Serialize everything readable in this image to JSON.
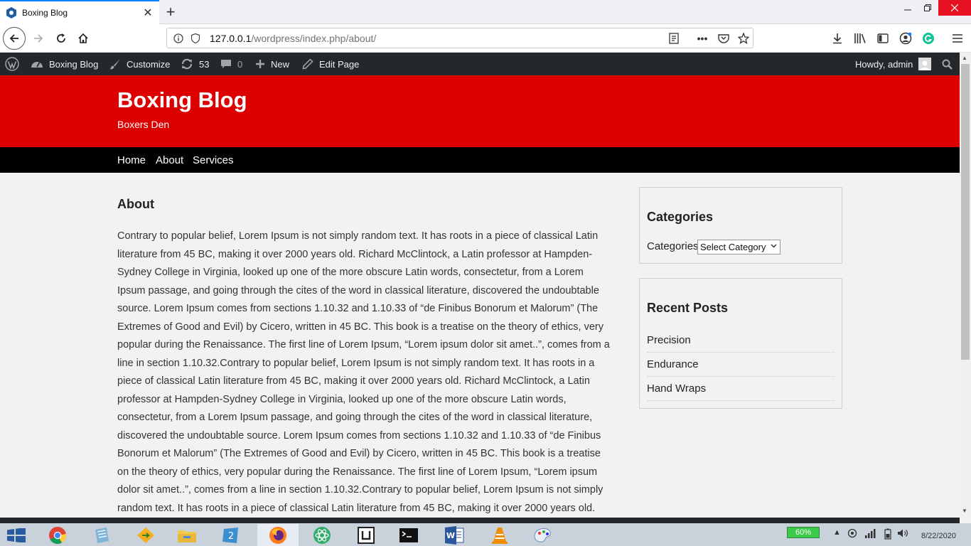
{
  "browser": {
    "tab_title": "Boxing Blog",
    "url_host": "127.0.0.1",
    "url_path": "/wordpress/index.php/about/",
    "new_tab": "+",
    "tab_close": "✕"
  },
  "adminbar": {
    "site_name": "Boxing Blog",
    "customize": "Customize",
    "updates_count": "53",
    "comments_count": "0",
    "new_label": "New",
    "edit_page": "Edit Page",
    "howdy": "Howdy, admin"
  },
  "site": {
    "title": "Boxing Blog",
    "description": "Boxers Den",
    "nav": [
      "Home",
      "About",
      "Services"
    ]
  },
  "page": {
    "title": "About",
    "body": "Contrary to popular belief, Lorem Ipsum is not simply random text. It has roots in a piece of classical Latin literature from 45 BC, making it over 2000 years old. Richard McClintock, a Latin professor at Hampden-Sydney College in Virginia, looked up one of the more obscure Latin words, consectetur, from a Lorem Ipsum passage, and going through the cites of the word in classical literature, discovered the undoubtable source. Lorem Ipsum comes from sections 1.10.32 and 1.10.33 of “de Finibus Bonorum et Malorum” (The Extremes of Good and Evil) by Cicero, written in 45 BC. This book is a treatise on the theory of ethics, very popular during the Renaissance. The first line of Lorem Ipsum, “Lorem ipsum dolor sit amet..”, comes from a line in section 1.10.32.Contrary to popular belief, Lorem Ipsum is not simply random text. It has roots in a piece of classical Latin literature from 45 BC, making it over 2000 years old. Richard McClintock, a Latin professor at Hampden-Sydney College in Virginia, looked up one of the more obscure Latin words, consectetur, from a Lorem Ipsum passage, and going through the cites of the word in classical literature, discovered the undoubtable source. Lorem Ipsum comes from sections 1.10.32 and 1.10.33 of “de Finibus Bonorum et Malorum” (The Extremes of Good and Evil) by Cicero, written in 45 BC. This book is a treatise on the theory of ethics, very popular during the Renaissance. The first line of Lorem Ipsum, “Lorem ipsum dolor sit amet..”, comes from a line in section 1.10.32.Contrary to popular belief, Lorem Ipsum is not simply random text. It has roots in a piece of classical Latin literature from 45 BC, making it over 2000 years old."
  },
  "sidebar": {
    "categories": {
      "title": "Categories",
      "label": "Categories",
      "selected": "Select Category"
    },
    "recent_posts": {
      "title": "Recent Posts",
      "items": [
        "Precision",
        "Endurance",
        "Hand Wraps"
      ]
    }
  },
  "taskbar": {
    "battery": "60%",
    "date": "8/22/2020"
  },
  "colors": {
    "header_red": "#dd0000",
    "admin_bar": "#23282d",
    "nav_black": "#000000"
  }
}
